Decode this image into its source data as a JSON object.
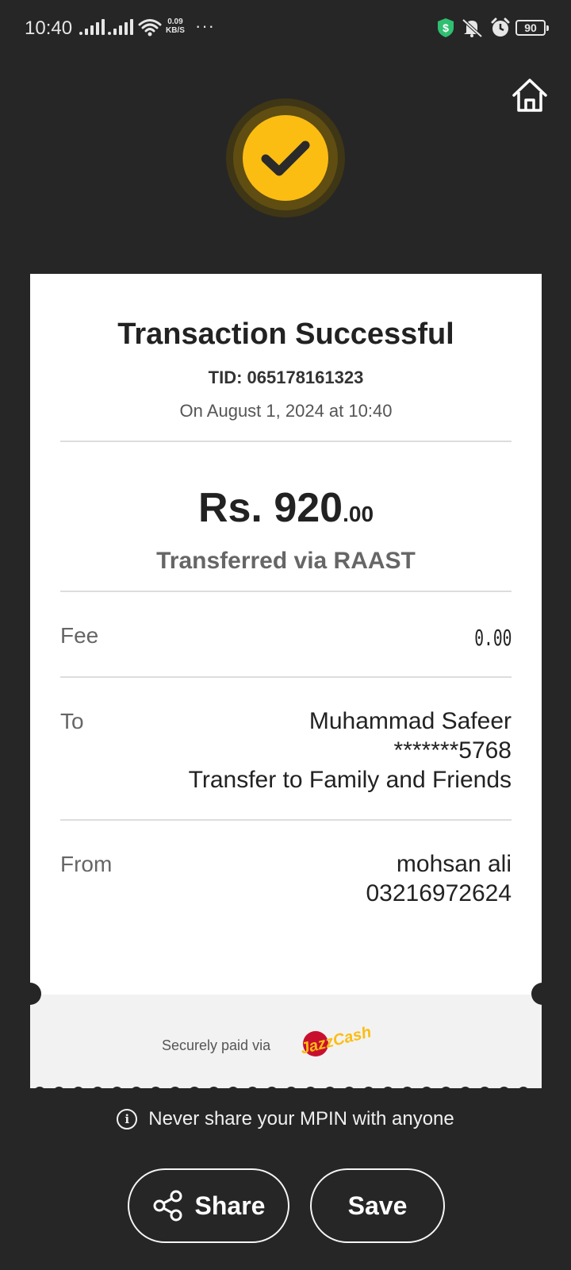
{
  "status_bar": {
    "time": "10:40",
    "net_speed_value": "0.09",
    "net_speed_unit": "KB/S",
    "more": "···",
    "battery": "90"
  },
  "receipt": {
    "title": "Transaction Successful",
    "tid": "TID: 065178161323",
    "date": "On August 1, 2024 at 10:40",
    "amount_main": "Rs. 920",
    "amount_decimal": ".00",
    "via": "Transferred via RAAST",
    "fee_label": "Fee",
    "fee_value": "0.00",
    "to_label": "To",
    "to_name": "Muhammad Safeer",
    "to_account": "*******5768",
    "to_purpose": "Transfer to Family and Friends",
    "from_label": "From",
    "from_name": "mohsan ali",
    "from_number": "03216972624",
    "secure_text": "Securely paid via",
    "logo_text": "JazzCash"
  },
  "notice": "Never share your MPIN with anyone",
  "info_glyph": "i",
  "buttons": {
    "share": "Share",
    "save": "Save"
  },
  "colors": {
    "background": "#262626",
    "accent": "#fbbd12",
    "card": "#ffffff"
  }
}
